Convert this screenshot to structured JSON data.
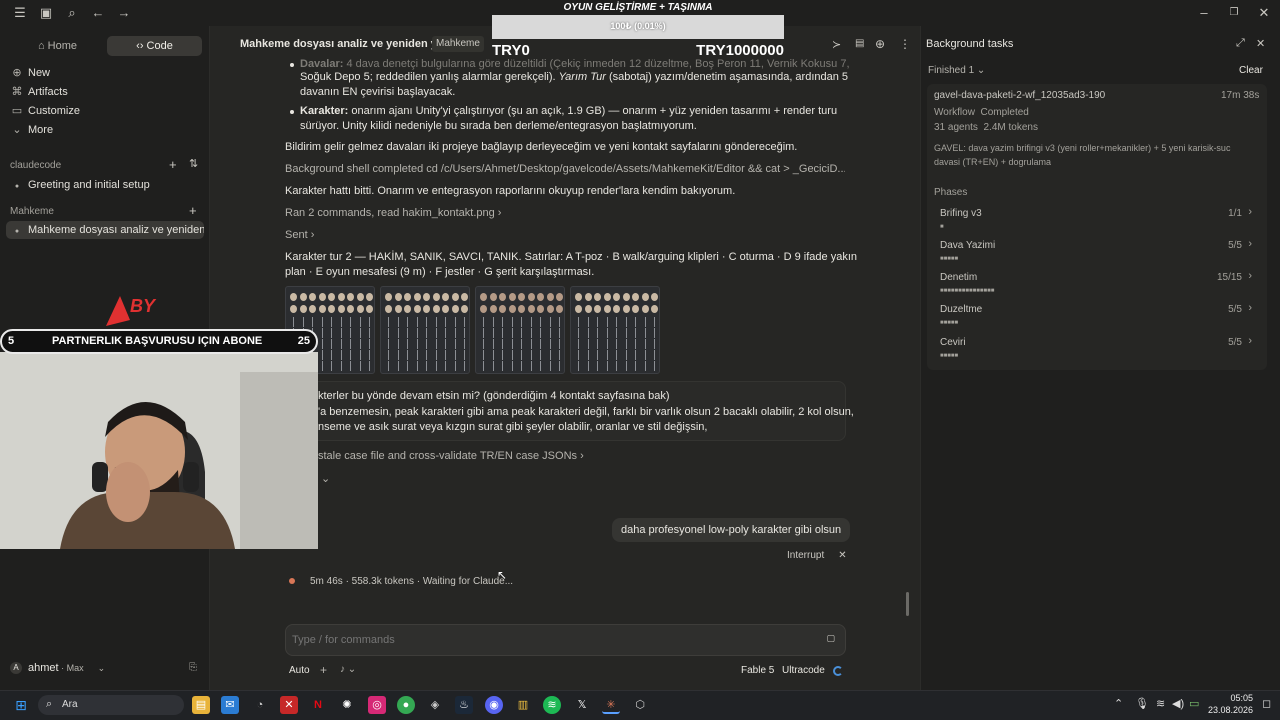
{
  "titlebar": {
    "icons": [
      "menu-icon",
      "sidebar-toggle-icon",
      "search-icon",
      "back-icon",
      "forward-icon"
    ],
    "window_controls": [
      "minimize-icon",
      "restore-icon",
      "close-icon"
    ]
  },
  "overlay_goal": {
    "title": "OYUN GELİŞTİRME + TAŞINMA",
    "progress_text": "100₺ (0.01%)",
    "progress_percent": 0.01,
    "min_label": "TRY0",
    "max_label": "TRY1000000"
  },
  "sidebar": {
    "tabs": [
      {
        "label": "Home"
      },
      {
        "label": "Code"
      }
    ],
    "active_tab": "Code",
    "nav": [
      {
        "label": "New",
        "icon": "plus-icon"
      },
      {
        "label": "Artifacts",
        "icon": "artifacts-icon"
      },
      {
        "label": "Customize",
        "icon": "customize-icon"
      },
      {
        "label": "More",
        "icon": "chevron-down-icon"
      }
    ],
    "sections": [
      {
        "title": "claudecode",
        "items": [
          "Greeting and initial setup"
        ]
      },
      {
        "title": "Mahkeme",
        "items": [
          "Mahkeme dosyası analiz ve yeniden ya"
        ]
      }
    ],
    "user": {
      "initial": "A",
      "name": "ahmet",
      "plan": "Max"
    }
  },
  "header": {
    "title": "Mahkeme dosyası analiz ve yeniden yazım",
    "badge": "Mahkeme"
  },
  "conversation": {
    "bullets": [
      {
        "bold": "Davalar:",
        "text": " 4 dava denetçi bulgularına göre düzeltildi (Çekiç inmeden 12 düzeltme, Boş Peron 11, Vernik Kokusu 7,",
        "text2": "Soğuk Depo 5; reddedilen yanlış alarmlar gerekçeli). ",
        "italic": "Yarım Tur",
        "text3": " (sabotaj) yazım/denetim aşamasında, ardından 5",
        "text4": "davanın EN çevirisi başlayacak."
      },
      {
        "bold": "Karakter:",
        "text": " onarım ajanı Unity'yi çalıştırıyor (şu an açık, 1.9 GB) — onarım + yüz yeniden tasarımı + render turu",
        "text2": "sürüyor. Unity kilidi nedeniyle bu sırada ben derleme/entegrasyon başlatmıyorum."
      }
    ],
    "p1": "Bildirim gelir gelmez davaları iki projeye bağlayıp derleyeceğim ve yeni kontakt sayfalarını göndereceğim.",
    "shell": "Background shell completed cd /c/Users/Ahmet/Desktop/gavelcode/Assets/MahkemeKit/Editor && cat > _GeciciD...",
    "p2": "Karakter hattı bitti. Onarım ve entegrasyon raporlarını okuyup render'lara kendim bakıyorum.",
    "ran": "Ran 2 commands, read hakim_kontakt.png",
    "sent": "Sent",
    "p3a": "Karakter tur 2 — HAKİM, SANIK, SAVCI, TANIK. Satırlar: A T-poz · B walk/arguing klipleri · C oturma · D 9 ifade yakın",
    "p3b": "plan · E oyun mesafesi (9 m) · F jestler · G şerit karşılaştırması.",
    "quote1": "kterler bu yönde devam etsin mi? (gönderdiğim 4 kontakt sayfasına bak)",
    "quote2": "'a benzemesin, peak karakteri gibi ama peak karakteri değil, farklı bir varlık olsun 2 bacaklı olabilir, 2 kol olsun,",
    "quote3": "nseme ve asık surat veya kızgın surat gibi şeyler olabilir, oranlar ve stil değişsin,",
    "stale": "stale case file and cross-validate TR/EN case JSONs",
    "user_msg": "daha profesyonel low-poly karakter gibi olsun",
    "interrupt": "Interrupt",
    "status": "5m 46s · 558.3k tokens · Waiting for Claude..."
  },
  "composer": {
    "placeholder": "Type / for commands",
    "mode": "Auto",
    "model": "Fable 5",
    "effort": "Ultracode"
  },
  "right_panel": {
    "title": "Background tasks",
    "filter": "Finished 1",
    "clear": "Clear",
    "task": {
      "name": "gavel-dava-paketi-2-wf_12035ad3-190",
      "time": "17m 38s",
      "type": "Workflow",
      "state": "Completed",
      "agents": "31 agents",
      "tokens": "2.4M tokens",
      "desc1": "GAVEL: dava yazim brifingi v3 (yeni roller+mekanikler) + 5 yeni karisik-suc",
      "desc2": "davasi (TR+EN) + dogrulama"
    },
    "phases_title": "Phases",
    "phases": [
      {
        "name": "Brifing v3",
        "count": "1/1",
        "dots": "■"
      },
      {
        "name": "Dava Yazimi",
        "count": "5/5",
        "dots": "■■■■■"
      },
      {
        "name": "Denetim",
        "count": "15/15",
        "dots": "■■■■■■■■■■■■■■■"
      },
      {
        "name": "Duzeltme",
        "count": "5/5",
        "dots": "■■■■■"
      },
      {
        "name": "Ceviri",
        "count": "5/5",
        "dots": "■■■■■"
      }
    ]
  },
  "webcam": {
    "banner_left": "5",
    "banner_text": "PARTNERLIK BAŞVURUSU IÇIN ABONE",
    "banner_right": "25"
  },
  "taskbar": {
    "search_placeholder": "Ara",
    "time": "05:05",
    "date": "23.08.2026"
  }
}
